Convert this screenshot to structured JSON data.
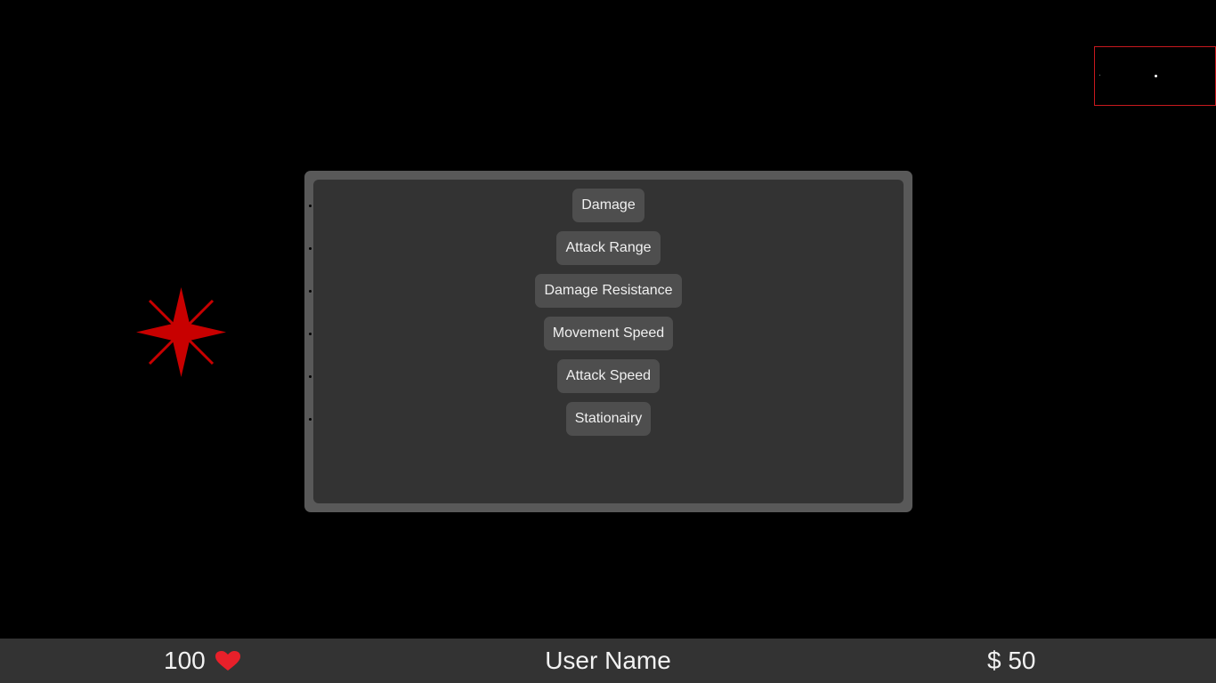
{
  "upgrades": [
    {
      "label": "Damage"
    },
    {
      "label": "Attack Range"
    },
    {
      "label": "Damage Resistance"
    },
    {
      "label": "Movement Speed"
    },
    {
      "label": "Attack Speed"
    },
    {
      "label": "Stationairy"
    }
  ],
  "hud": {
    "health": "100",
    "heart_icon": "heart-icon",
    "username": "User Name",
    "money": "$ 50"
  },
  "colors": {
    "enemy": "#c80000",
    "minimap_border": "#c8191e",
    "heart": "#e8202a",
    "panel_outer": "#595959",
    "panel_inner": "#333333",
    "button": "#4e4e4e",
    "hud_bar": "#333333"
  },
  "icons": {
    "enemy": "red-star-enemy-icon",
    "minimap_player": "white-dot-icon"
  }
}
